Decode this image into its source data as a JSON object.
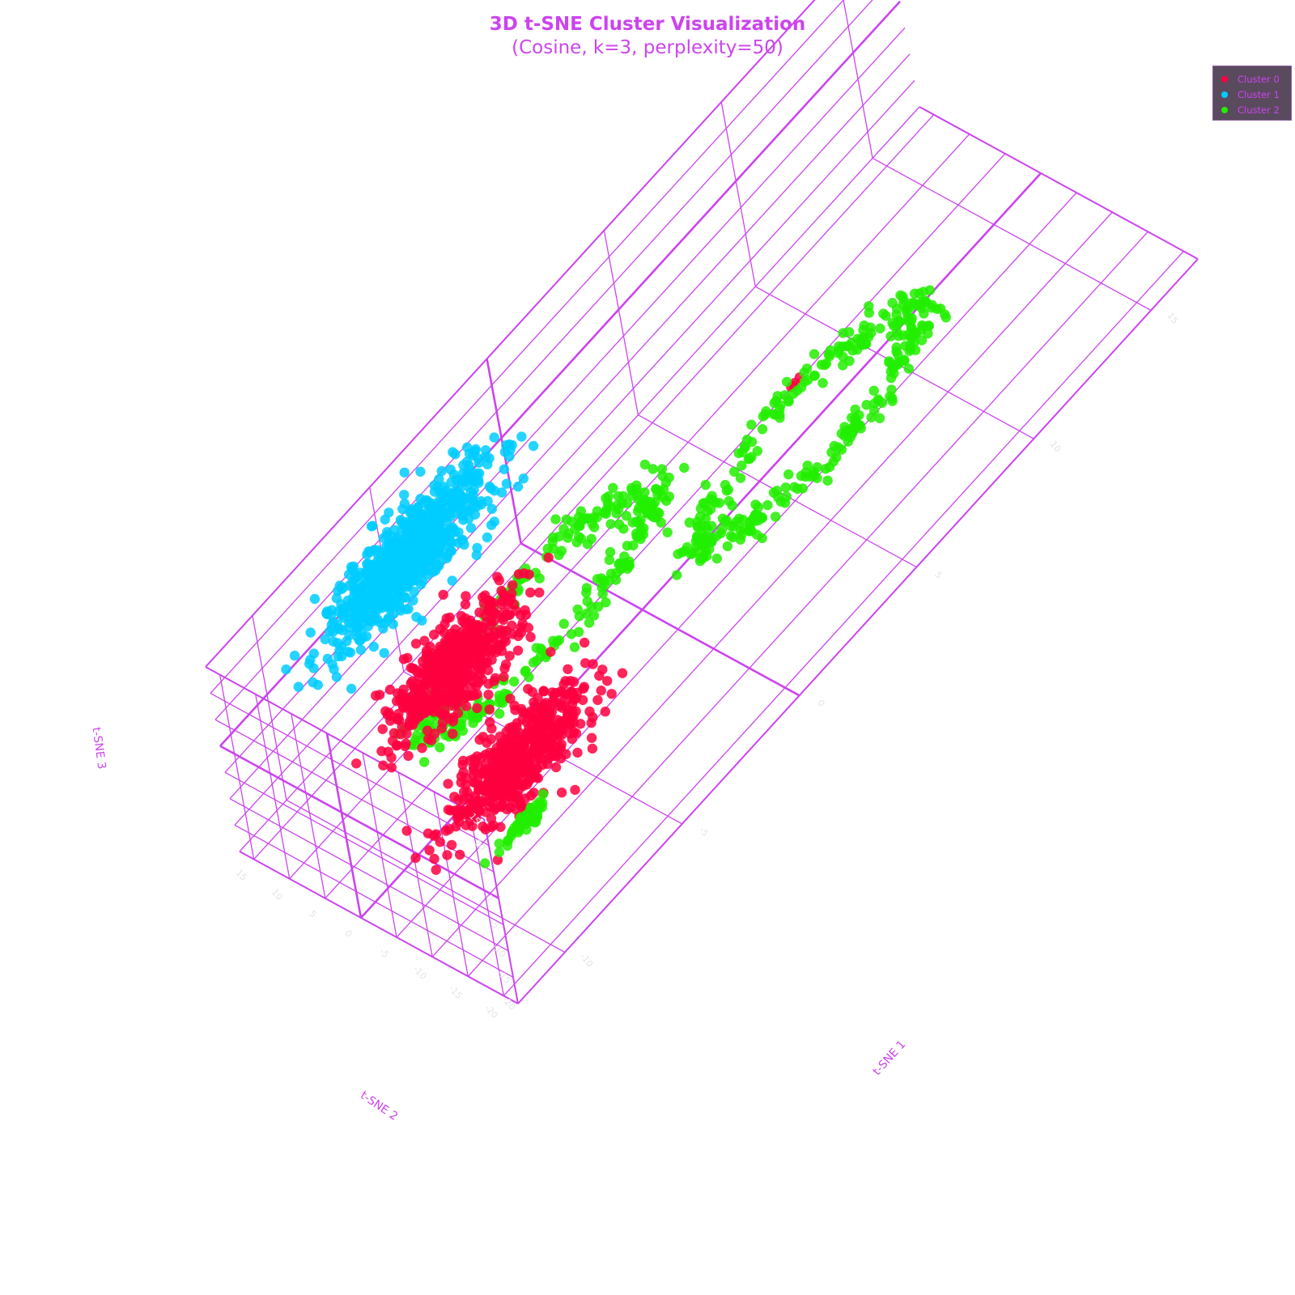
{
  "chart_data": {
    "type": "scatter",
    "subtype": "scatter3d",
    "title": "3D t-SNE Cluster Visualization",
    "subtitle": "(Cosine, k=3, perplexity=50)",
    "xlabel": "t-SNE 1",
    "ylabel": "t-SNE 2",
    "zlabel": "t-SNE 3",
    "x_ticks": [
      "-10",
      "-5",
      "0",
      "5",
      "10",
      "15"
    ],
    "y_ticks": [
      "-20",
      "-15",
      "-10",
      "-5",
      "0",
      "5",
      "10",
      "15"
    ],
    "z_ticks": [
      "-20",
      "-15",
      "-10",
      "-5",
      "0",
      "5",
      "10",
      "15"
    ],
    "xlim": [
      -12,
      17
    ],
    "ylim": [
      -22,
      17
    ],
    "zlim": [
      -20,
      15
    ],
    "grid": true,
    "legend_position": "top-right",
    "series": [
      {
        "name": "Cluster 0",
        "color": "#ff0040",
        "clusters": [
          {
            "center": [
              -8,
              -4,
              11
            ],
            "spread": [
              2.5,
              3.5,
              3.2
            ],
            "count": 520
          },
          {
            "center": [
              -8,
              -12,
              0
            ],
            "spread": [
              2.5,
              3.5,
              3.4
            ],
            "count": 560
          },
          {
            "center": [
              8,
              4,
              -18
            ],
            "spread": [
              0.3,
              0.3,
              0.3
            ],
            "count": 4
          }
        ]
      },
      {
        "name": "Cluster 1",
        "color": "#00ccff",
        "clusters": [
          {
            "center": [
              -5,
              13,
              5
            ],
            "spread": [
              3,
              3,
              4.5
            ],
            "count": 780
          }
        ]
      },
      {
        "name": "Cluster 2",
        "color": "#22ee00",
        "rings": [
          {
            "center": [
              6,
              -5,
              -11
            ],
            "radius": 4.5,
            "thickness": 1,
            "count": 330
          },
          {
            "center": [
              -3,
              3,
              -8
            ],
            "radius": 4.5,
            "thickness": 1,
            "count": 330
          }
        ],
        "clusters": [
          {
            "center": [
              -10,
              -19,
              2
            ],
            "spread": [
              0.8,
              0.8,
              0.6
            ],
            "count": 45
          }
        ]
      }
    ]
  }
}
